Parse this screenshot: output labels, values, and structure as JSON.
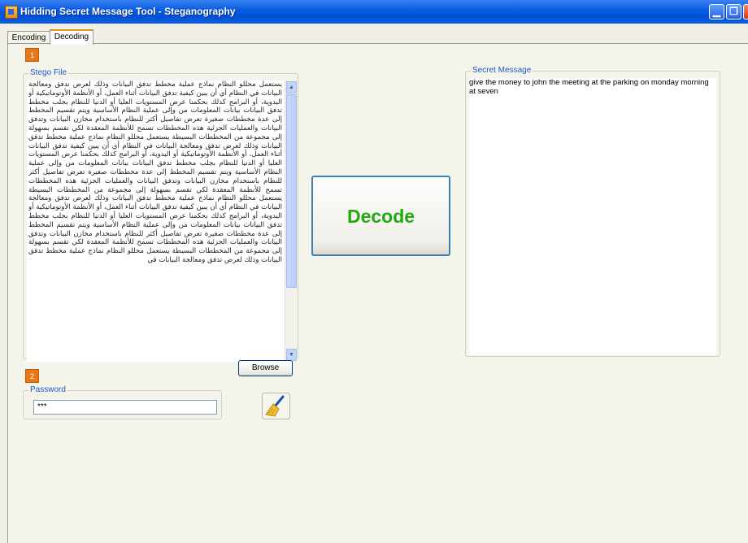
{
  "window": {
    "title": "Hidding Secret Message Tool - Steganography",
    "icon": "app-icon",
    "controls": [
      "minimize-icon",
      "restore-icon",
      "close-icon"
    ]
  },
  "tabs": [
    {
      "label": "Encoding"
    },
    {
      "label": "Decoding"
    }
  ],
  "steps": [
    "1",
    "2"
  ],
  "stego_file": {
    "legend": "Stego File",
    "content": "يستعمل محللو النظام نماذج عملية مخطط تدفق البيانات وذلك لعرض تدفق ومعالجة البيانات في النظام أي أن يبين كيفية تدفق البيانات أثناء العمل، أو الأنظمة الأوتوماتيكية أو اليدوية، أو البرامج كذلك بحكمنا عرض المستويات العليا أو الدنيا للنظام بجلب مخطط تدفق البيانات بيانات المعلومات من وإلى عملية النظام الأساسية ويتم تقسيم المخطط إلى عدة مخططات صغيرة تعرض تفاصيل أكثر للنظام باستخدام مخازن البيانات وتدفق البيانات والعمليات الجزئية هذه المخططات تسمح للأنظمة المعقدة لكي تقسم بسهولة إلى مجموعة من المخططات البسيطة يستعمل محللو النظام نماذج عملية مخطط تدفق البيانات وذلك لعرض تدفق ومعالجة البيانات في النظام أي أن يبين كيفية تدفق البيانات أثناء العمل، أو الأنظمة الأوتوماتيكية أو اليدوية، أو البرامج كذلك بحكمنا عرض المستويات العليا أو الدنيا للنظام بجلب مخطط تدفق البيانات بيانات المعلومات من وإلى عملية النظام الأساسية ويتم تقسيم المخطط إلى عدة مخططات صغيرة تعرض تفاصيل أكثر للنظام باستخدام مخازن البيانات وتدفق البيانات والعمليات الجزئية هذه المخططات تسمح للأنظمة المعقدة لكي تقسم بسهولة إلى مجموعة من المخططات البسيطة يستعمل محللو النظام نماذج عملية مخطط تدفق البيانات وذلك لعرض تدفق ومعالجة البيانات في النظام أي أن يبين كيفية تدفق البيانات أثناء العمل، أو الأنظمة الأوتوماتيكية أو اليدوية، أو البرامج كذلك بحكمنا عرض المستويات العليا أو الدنيا للنظام بجلب مخطط تدفق البيانات بيانات المعلومات من وإلى عملية النظام الأساسية ويتم تقسيم المخطط إلى عدة مخططات صغيرة تعرض تفاصيل أكثر للنظام باستخدام مخازن البيانات وتدفق البيانات والعمليات الجزئية هذه المخططات تسمح للأنظمة المعقدة لكي تقسم بسهولة إلى مجموعة من المخططات البسيطة يستعمل محللو النظام نماذج عملية مخطط تدفق البيانات وذلك لعرض تدفق ومعالجة البيانات في"
  },
  "browse_label": "Browse",
  "password": {
    "legend": "Password",
    "value": "***"
  },
  "decode_label": "Decode",
  "clear_icon": "broom-icon",
  "secret_message": {
    "legend": "Secret Message",
    "text": "give the money to john the meeting at the parking on monday morning at seven"
  }
}
